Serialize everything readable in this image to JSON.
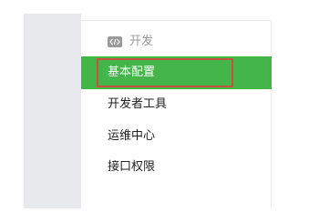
{
  "sidebar": {
    "section": {
      "icon": "code-icon",
      "label": "开发"
    },
    "items": [
      {
        "label": "基本配置",
        "active": true
      },
      {
        "label": "开发者工具",
        "active": false
      },
      {
        "label": "运维中心",
        "active": false
      },
      {
        "label": "接口权限",
        "active": false
      }
    ]
  },
  "colors": {
    "active_background": "#44b549",
    "highlight_border": "#c8523b",
    "muted_text": "#9a9a9a",
    "text": "#222222",
    "gutter": "#e8e9ec"
  }
}
